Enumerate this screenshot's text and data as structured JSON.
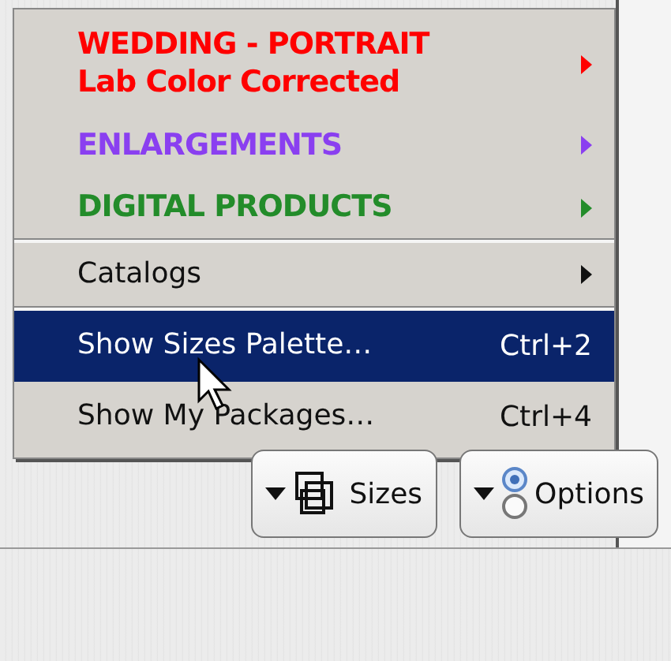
{
  "menu": {
    "groups": [
      {
        "items": [
          {
            "kind": "submenu",
            "label": "WEDDING - PORTRAIT",
            "sublabel": "Lab Color Corrected",
            "color": "#ff0000",
            "selected": false
          },
          {
            "kind": "submenu",
            "label": "ENLARGEMENTS",
            "color": "#8a3ff0",
            "selected": false
          },
          {
            "kind": "submenu",
            "label": "DIGITAL PRODUCTS",
            "color": "#238c2a",
            "selected": false
          }
        ]
      },
      {
        "items": [
          {
            "kind": "submenu",
            "label": "Catalogs",
            "selected": false
          }
        ]
      },
      {
        "items": [
          {
            "kind": "command",
            "label": "Show Sizes Palette…",
            "shortcut": "Ctrl+2",
            "selected": true
          },
          {
            "kind": "command",
            "label": "Show My Packages…",
            "shortcut": "Ctrl+4",
            "selected": false
          }
        ]
      }
    ]
  },
  "toolbar": {
    "buttons": [
      {
        "kind": "sizes",
        "label": "Sizes"
      },
      {
        "kind": "options",
        "label": "Options"
      }
    ]
  }
}
